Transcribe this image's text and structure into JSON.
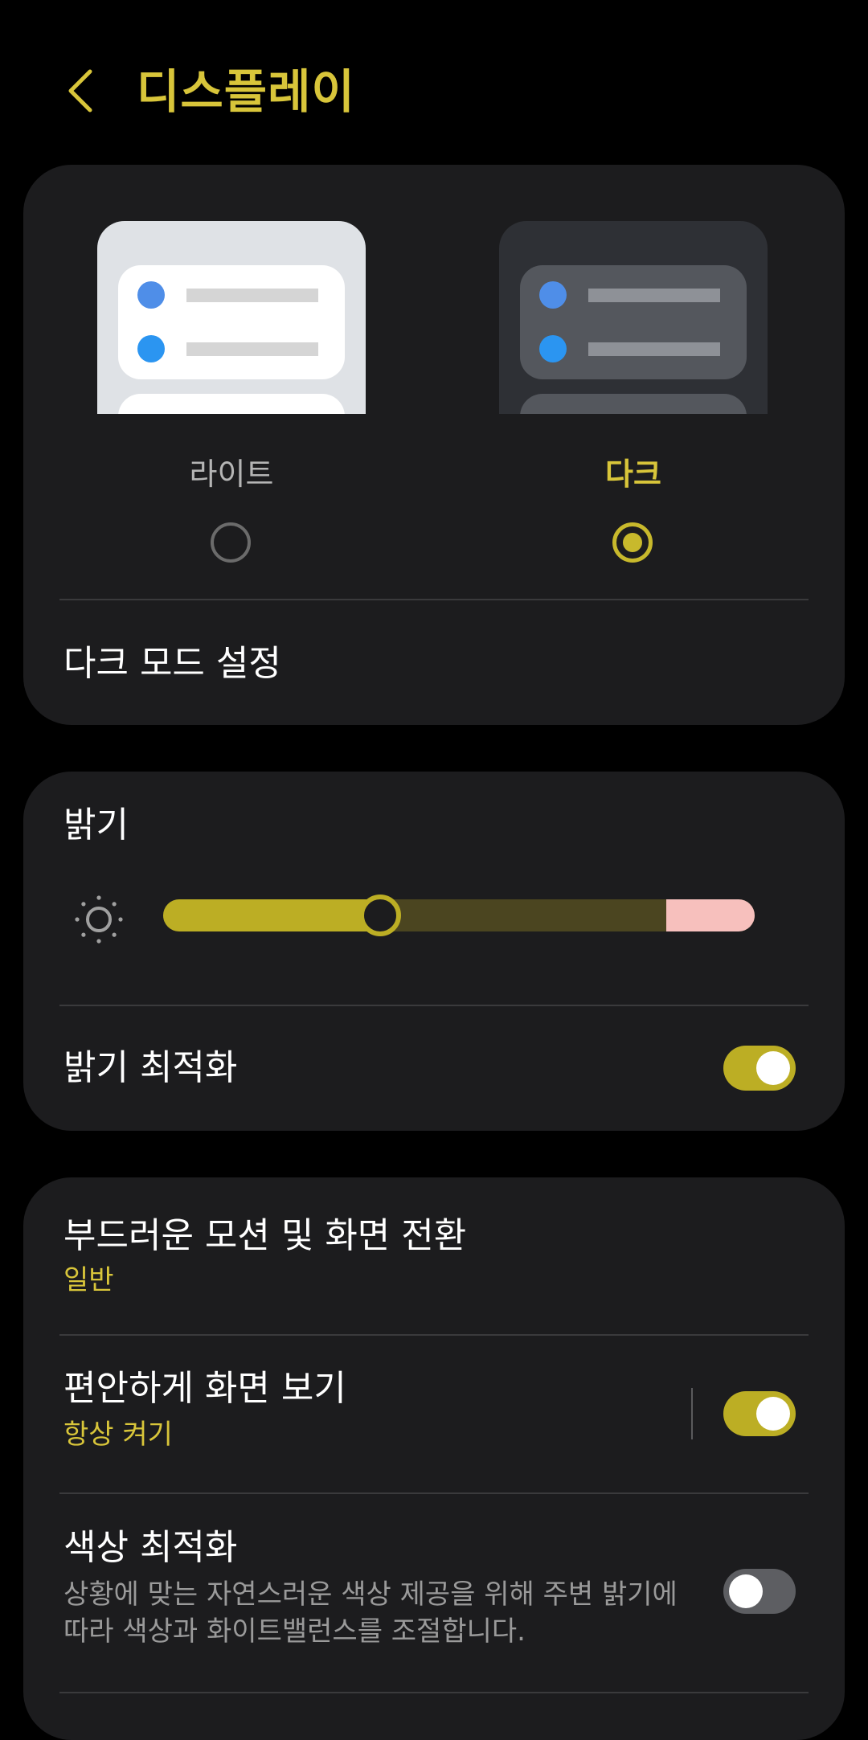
{
  "header": {
    "title": "디스플레이",
    "back_icon": "chevron-left-icon"
  },
  "colors": {
    "accent": "#d8c53a",
    "toggle_on": "#bcae24",
    "card_bg": "#1c1c1e",
    "background": "#000000"
  },
  "theme": {
    "light_label": "라이트",
    "dark_label": "다크",
    "selected": "dark"
  },
  "dark_mode_settings": {
    "label": "다크 모드 설정"
  },
  "brightness": {
    "title": "밝기",
    "icon": "sun-icon",
    "value_fraction": 0.34,
    "extra_fraction": 0.15
  },
  "adaptive_brightness": {
    "label": "밝기 최적화",
    "on": true
  },
  "motion_smoothness": {
    "label": "부드러운 모션 및 화면 전환",
    "value": "일반"
  },
  "eye_comfort": {
    "label": "편안하게 화면 보기",
    "value": "항상 켜기",
    "on": true
  },
  "adaptive_color": {
    "label": "색상 최적화",
    "description": "상황에 맞는 자연스러운 색상 제공을 위해 주변 밝기에 따라 색상과 화이트밸런스를 조절합니다.",
    "on": false
  }
}
